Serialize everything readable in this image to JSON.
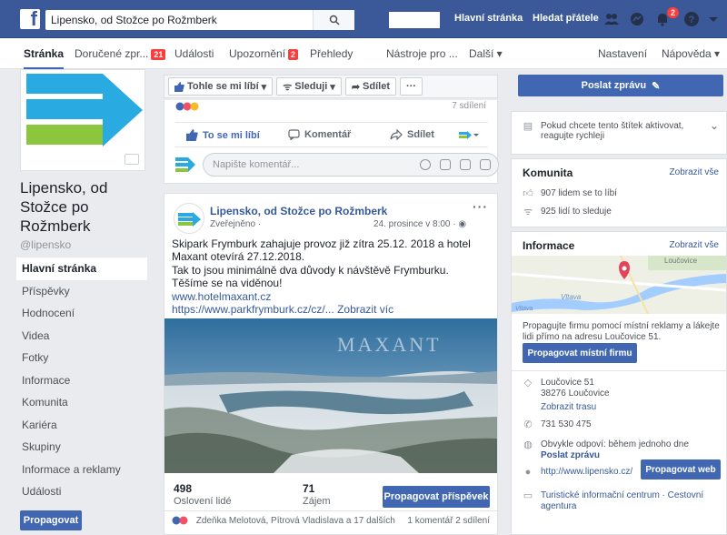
{
  "topbar": {
    "search_value": "Lipensko, od Stožce po Rožmberk",
    "home_link": "Hlavní stránka",
    "find_friends_link": "Hledat přátele",
    "notif_badge": "2"
  },
  "page_nav": {
    "items": [
      {
        "label": "Stránka"
      },
      {
        "label": "Doručené zpr...",
        "badge": "21"
      },
      {
        "label": "Události"
      },
      {
        "label": "Upozornění",
        "badge": "2"
      },
      {
        "label": "Přehledy"
      },
      {
        "label": "Nástroje pro ..."
      },
      {
        "label": "Další ▾"
      },
      {
        "label": "Nastavení"
      },
      {
        "label": "Nápověda ▾"
      }
    ]
  },
  "left": {
    "page_name": "Lipensko, od Stožce po Rožmberk",
    "handle": "@lipensko",
    "nav": [
      "Hlavní stránka",
      "Příspěvky",
      "Hodnocení",
      "Videa",
      "Fotky",
      "Informace",
      "Komunita",
      "Kariéra",
      "Skupiny",
      "Informace a reklamy",
      "Události"
    ],
    "promote_label": "Propagovat"
  },
  "actionbar": {
    "like": "Tohle se mi líbí",
    "follow": "Sleduji",
    "share": "Sdílet",
    "more": "···"
  },
  "post1": {
    "top_right": "7 sdílení",
    "like": "To se mi líbí",
    "comment": "Komentář",
    "share": "Sdílet",
    "comment_placeholder": "Napište komentář..."
  },
  "post2": {
    "author": "Lipensko, od Stožce po Rožmberk",
    "visibility": "Zveřejněno ·",
    "date": "24. prosince v 8:00 ·",
    "text_lines": [
      "Skipark Frymburk zahajuje provoz již zítra 25.12. 2018 a hotel Maxant otevírá 27.12.2018.",
      "Tak to jsou minimálně dva důvody k návštěvě Frymburku.",
      "Těšíme se na viděnou!"
    ],
    "link1": "www.hotelmaxant.cz",
    "link2": "https://www.parkfrymburk.cz/cz/...",
    "more": "Zobrazit víc",
    "watermark": "MAXANT",
    "reach_num": "498",
    "reach_label": "Oslovení lidé",
    "engage_num": "71",
    "engage_label": "Zájem",
    "promote_post": "Propagovat příspěvek",
    "footer_left": "Zdeňka Melotová, Pítrová Vladislava a 17 dalších",
    "footer_right": "1 komentář  2 sdílení"
  },
  "right": {
    "send_message": "Poslat zprávu",
    "tag_note": "Pokud chcete tento štítek aktivovat, reagujte rychleji",
    "community_title": "Komunita",
    "show_all": "Zobrazit vše",
    "likes": "907 lidem se to líbí",
    "follows": "925 lidí to sleduje",
    "info_title": "Informace",
    "map_labels": [
      "Loučovice",
      "Vltava",
      "Vltava"
    ],
    "promote_text": "Propagujte firmu pomocí místní reklamy a lákejte lidi přímo na adresu Loučovice 51.",
    "promote_local": "Propagovat místní firmu",
    "address1": "Loučovice 51",
    "address2": "38276 Loučovice",
    "route": "Zobrazit trasu",
    "phone": "731 530 475",
    "response": "Obvykle odpoví: během jednoho dne",
    "send_message_link": "Poslat zprávu",
    "website": "http://www.lipensko.cz/",
    "promote_web": "Propagovat web",
    "category": "Turistické informační centrum · Cestovní agentura"
  },
  "colors": {
    "fb_blue": "#3b5998",
    "button_blue": "#4267b2",
    "link_blue": "#365899",
    "badge_red": "#fa3e3e",
    "logo_cyan": "#29abe2",
    "logo_green": "#8cc63f"
  }
}
